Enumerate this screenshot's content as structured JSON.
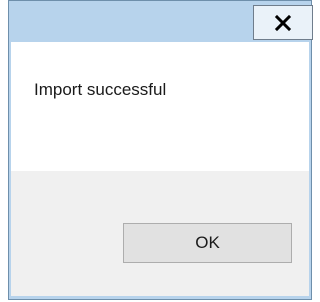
{
  "dialog": {
    "message": "Import successful",
    "ok_label": "OK",
    "close_icon": "close-icon"
  },
  "colors": {
    "frame": "#b7d3ec",
    "content_bg": "#ffffff",
    "footer_bg": "#f0f0f0",
    "button_bg": "#e1e1e1"
  }
}
